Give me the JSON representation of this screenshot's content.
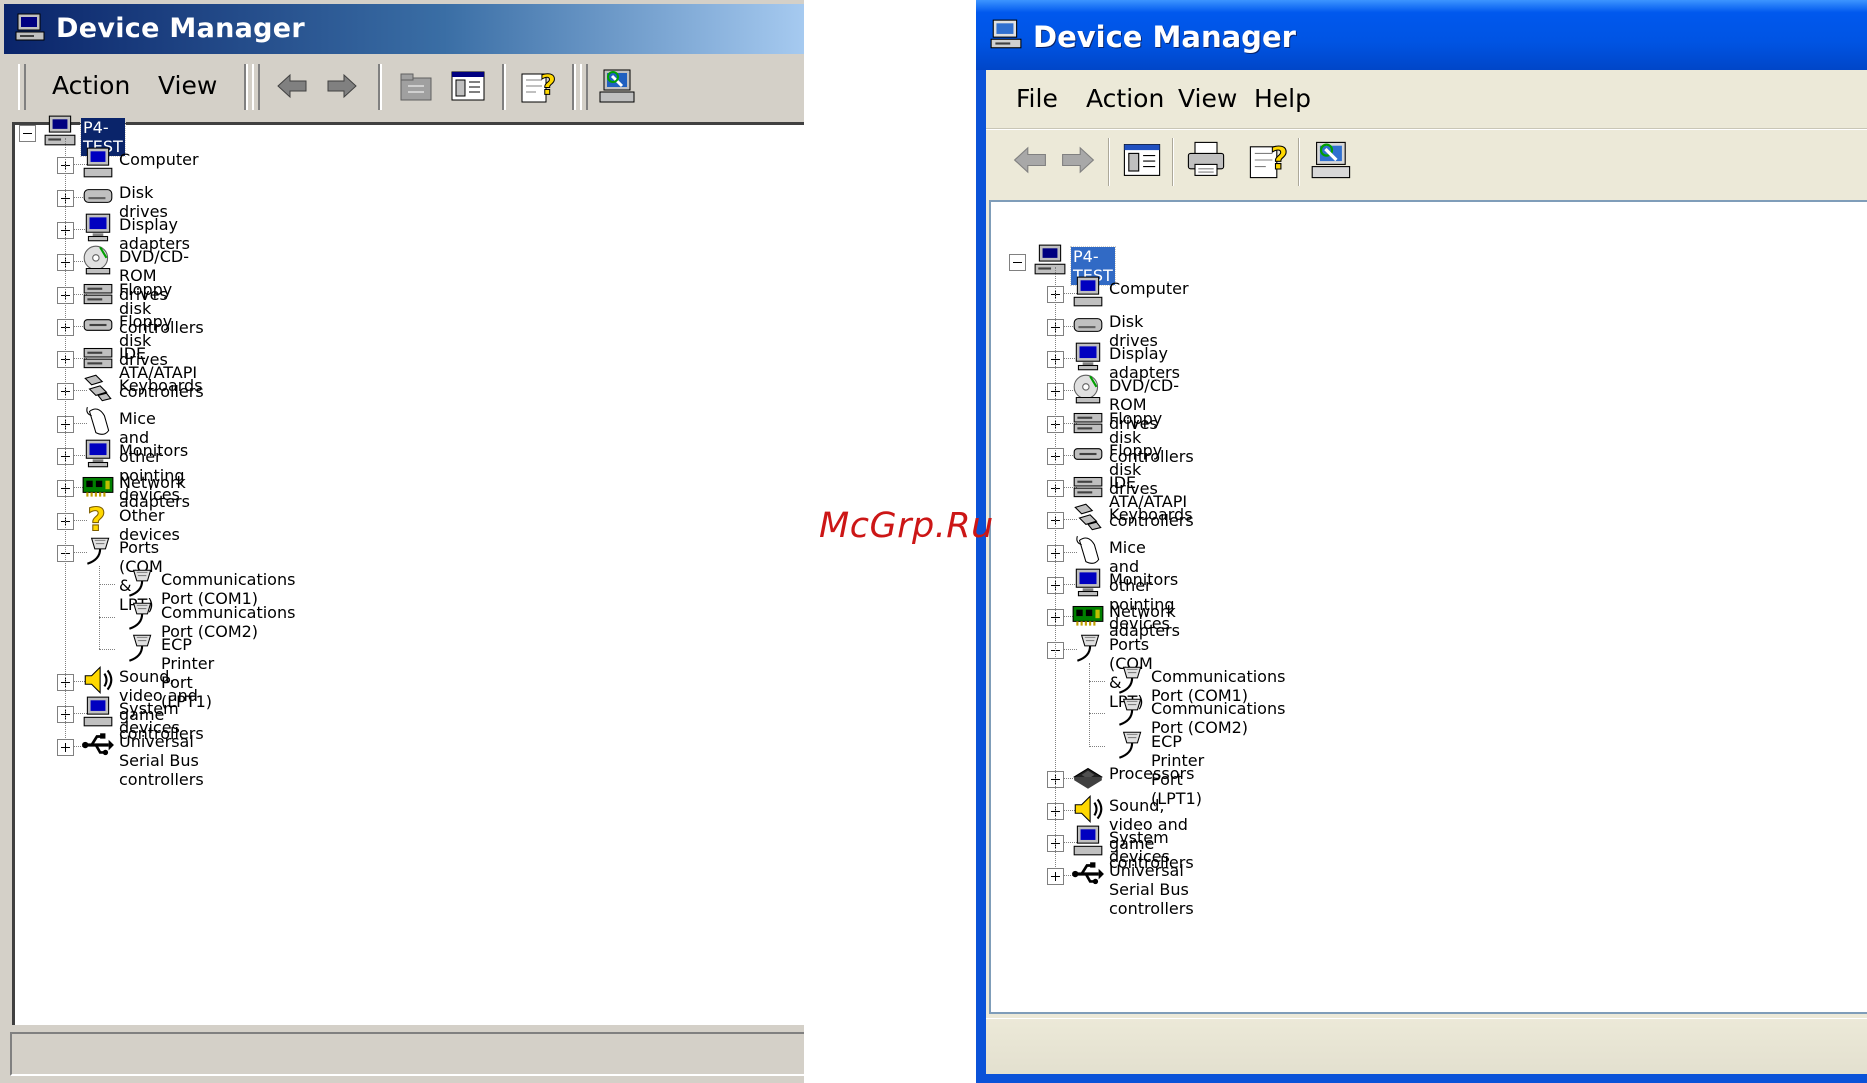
{
  "watermark": "McGrp.Ru",
  "w2k": {
    "title": "Device Manager",
    "menu": [
      "Action",
      "View"
    ],
    "root": "P4-TEST",
    "items": [
      {
        "label": "Computer",
        "icon": "computer-icon"
      },
      {
        "label": "Disk drives",
        "icon": "disk-drive-icon"
      },
      {
        "label": "Display adapters",
        "icon": "display-adapter-icon"
      },
      {
        "label": "DVD/CD-ROM drives",
        "icon": "cdrom-icon"
      },
      {
        "label": "Floppy disk controllers",
        "icon": "controller-icon"
      },
      {
        "label": "Floppy disk drives",
        "icon": "floppy-drive-icon"
      },
      {
        "label": "IDE ATA/ATAPI controllers",
        "icon": "controller-icon"
      },
      {
        "label": "Keyboards",
        "icon": "keyboard-icon"
      },
      {
        "label": "Mice and other pointing devices",
        "icon": "mouse-icon"
      },
      {
        "label": "Monitors",
        "icon": "monitor-icon"
      },
      {
        "label": "Network adapters",
        "icon": "network-adapter-icon"
      },
      {
        "label": "Other devices",
        "icon": "question-icon"
      },
      {
        "label": "Ports (COM & LPT)",
        "icon": "port-icon",
        "expanded": true,
        "children": [
          "Communications Port (COM1)",
          "Communications Port (COM2)",
          "ECP Printer Port (LPT1)"
        ]
      },
      {
        "label": "Sound, video and game controllers",
        "icon": "sound-icon"
      },
      {
        "label": "System devices",
        "icon": "computer-icon"
      },
      {
        "label": "Universal Serial Bus controllers",
        "icon": "usb-icon"
      }
    ]
  },
  "wxp": {
    "title": "Device Manager",
    "menu": [
      "File",
      "Action",
      "View",
      "Help"
    ],
    "root": "P4-TEST",
    "items": [
      {
        "label": "Computer",
        "icon": "computer-icon"
      },
      {
        "label": "Disk drives",
        "icon": "disk-drive-icon"
      },
      {
        "label": "Display adapters",
        "icon": "display-adapter-icon"
      },
      {
        "label": "DVD/CD-ROM drives",
        "icon": "cdrom-icon"
      },
      {
        "label": "Floppy disk controllers",
        "icon": "controller-icon"
      },
      {
        "label": "Floppy disk drives",
        "icon": "floppy-drive-icon"
      },
      {
        "label": "IDE ATA/ATAPI controllers",
        "icon": "controller-icon"
      },
      {
        "label": "Keyboards",
        "icon": "keyboard-icon"
      },
      {
        "label": "Mice and other pointing devices",
        "icon": "mouse-icon"
      },
      {
        "label": "Monitors",
        "icon": "monitor-icon"
      },
      {
        "label": "Network adapters",
        "icon": "network-adapter-icon"
      },
      {
        "label": "Ports (COM & LPT)",
        "icon": "port-icon",
        "expanded": true,
        "children": [
          "Communications Port (COM1)",
          "Communications Port (COM2)",
          "ECP Printer Port (LPT1)"
        ]
      },
      {
        "label": "Processors",
        "icon": "processor-icon"
      },
      {
        "label": "Sound, video and game controllers",
        "icon": "sound-icon"
      },
      {
        "label": "System devices",
        "icon": "computer-icon"
      },
      {
        "label": "Universal Serial Bus controllers",
        "icon": "usb-icon"
      }
    ]
  }
}
